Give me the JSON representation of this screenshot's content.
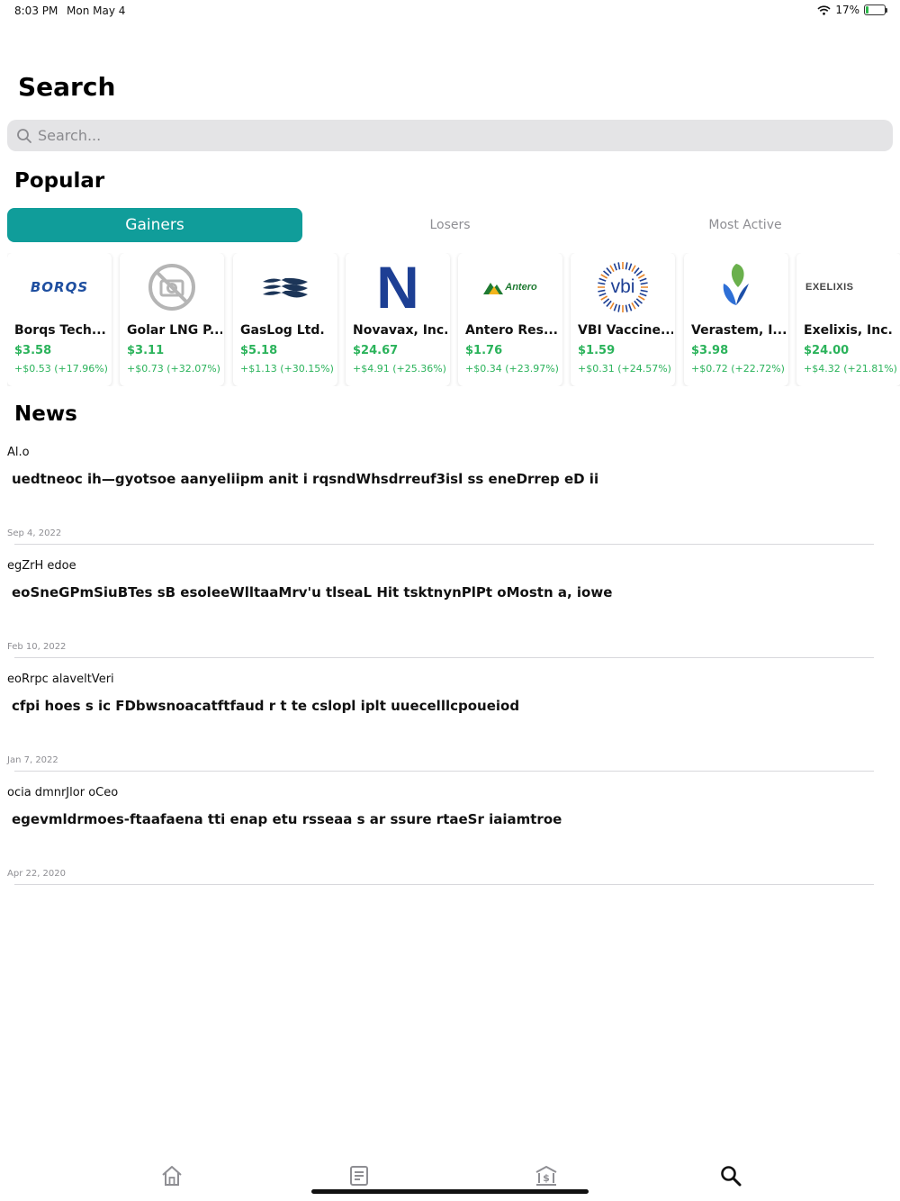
{
  "status_bar": {
    "time": "8:03 PM",
    "date": "Mon May 4",
    "battery": "17%",
    "battery_level": 0.17
  },
  "header": {
    "title": "Search"
  },
  "search": {
    "placeholder": "Search..."
  },
  "popular": {
    "title": "Popular",
    "tabs": [
      {
        "label": "Gainers",
        "active": true
      },
      {
        "label": "Losers",
        "active": false
      },
      {
        "label": "Most Active",
        "active": false
      }
    ],
    "cards": [
      {
        "logo": "BORQS",
        "logo_icon": "borqs-logo",
        "name": "Borqs Tech...",
        "price": "$3.58",
        "change": "+$0.53 (+17.96%)"
      },
      {
        "logo": "",
        "logo_icon": "no-photo-icon",
        "name": "Golar LNG P...",
        "price": "$3.11",
        "change": "+$0.73 (+32.07%)"
      },
      {
        "logo": "",
        "logo_icon": "gaslog-logo",
        "name": "GasLog Ltd.",
        "price": "$5.18",
        "change": "+$1.13 (+30.15%)"
      },
      {
        "logo": "N",
        "logo_icon": "novavax-logo",
        "name": "Novavax, Inc.",
        "price": "$24.67",
        "change": "+$4.91 (+25.36%)"
      },
      {
        "logo": "Antero",
        "logo_icon": "antero-logo",
        "name": "Antero Res...",
        "price": "$1.76",
        "change": "+$0.34 (+23.97%)"
      },
      {
        "logo": "vbi",
        "logo_icon": "vbi-logo",
        "name": "VBI Vaccine...",
        "price": "$1.59",
        "change": "+$0.31 (+24.57%)"
      },
      {
        "logo": "",
        "logo_icon": "verastem-logo",
        "name": "Verastem, I...",
        "price": "$3.98",
        "change": "+$0.72 (+22.72%)"
      },
      {
        "logo": "EXELIXIS",
        "logo_icon": "exelixis-logo",
        "name": "Exelixis, Inc.",
        "price": "$24.00",
        "change": "+$4.32 (+21.81%)"
      }
    ]
  },
  "news": {
    "title": "News",
    "items": [
      {
        "source": "Al.o",
        "headline": "uedtneoc ih—gyotsoe  aanyeliipm anit i  rqsndWhsdrreuf3isl  ss eneDrrep  eD ii",
        "date": "Sep 4, 2022"
      },
      {
        "source": "egZrH edoe",
        "headline": " eoSneGPmSiuBTes sB esoleeWlltaaMrv'u tlseaL Hit tsktnynPlPt   oMostn a, iowe",
        "date": "Feb 10, 2022"
      },
      {
        "source": "eoRrpc alaveltVeri",
        "headline": "cfpi hoes s   ic FDbwsnoacatftfaud r t te cslopl iplt uuecelllcpoueiod",
        "date": "Jan 7, 2022"
      },
      {
        "source": "ocia dmnrJlor oCeo",
        "headline": "egevmldrmoes-ftaafaena tti enap etu rsseaa s ar  ssure rtaeSr iaiamtroe",
        "date": "Apr 22, 2020"
      }
    ]
  },
  "tab_bar": {
    "items": [
      {
        "icon": "home-icon",
        "active": false
      },
      {
        "icon": "news-icon",
        "active": false
      },
      {
        "icon": "bank-icon",
        "active": false
      },
      {
        "icon": "search-icon",
        "active": true
      }
    ]
  },
  "colors": {
    "accent": "#109d9a",
    "gain": "#2bb35b",
    "inactive": "#8e8e93"
  }
}
